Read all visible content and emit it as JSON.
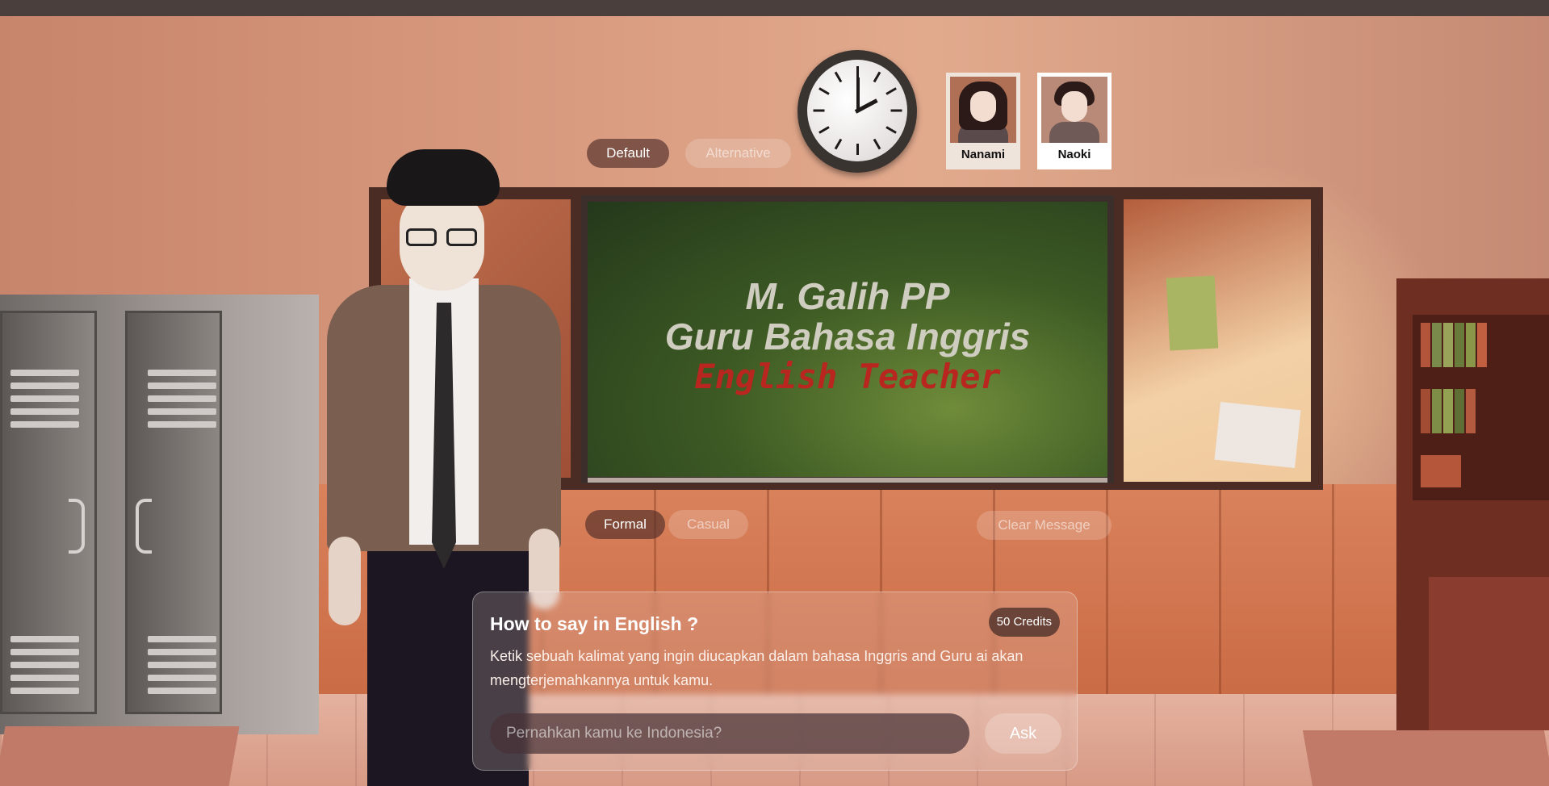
{
  "board": {
    "line1": "M. Galih PP",
    "line2": "Guru Bahasa Inggris",
    "line3": "English Teacher"
  },
  "outfit_toggle": {
    "default_label": "Default",
    "alternative_label": "Alternative",
    "selected": "Default"
  },
  "style_toggle": {
    "formal_label": "Formal",
    "casual_label": "Casual",
    "selected": "Formal"
  },
  "clear_message_label": "Clear Message",
  "teachers": [
    {
      "name": "Nanami",
      "selected": false
    },
    {
      "name": "Naoki",
      "selected": true
    }
  ],
  "panel": {
    "title": "How to say in English ?",
    "credits": "50 Credits",
    "description": "Ketik sebuah kalimat yang ingin diucapkan dalam bahasa Inggris and Guru ai akan mengterjemahkannya untuk kamu.",
    "input_placeholder": "Pernahkan kamu ke Indonesia?",
    "ask_label": "Ask"
  },
  "icons": {
    "clock": "clock-icon"
  },
  "colors": {
    "chalkboard_green": "#3d5a24",
    "board_red_text": "#b8261f",
    "active_pill": "#502d28"
  }
}
